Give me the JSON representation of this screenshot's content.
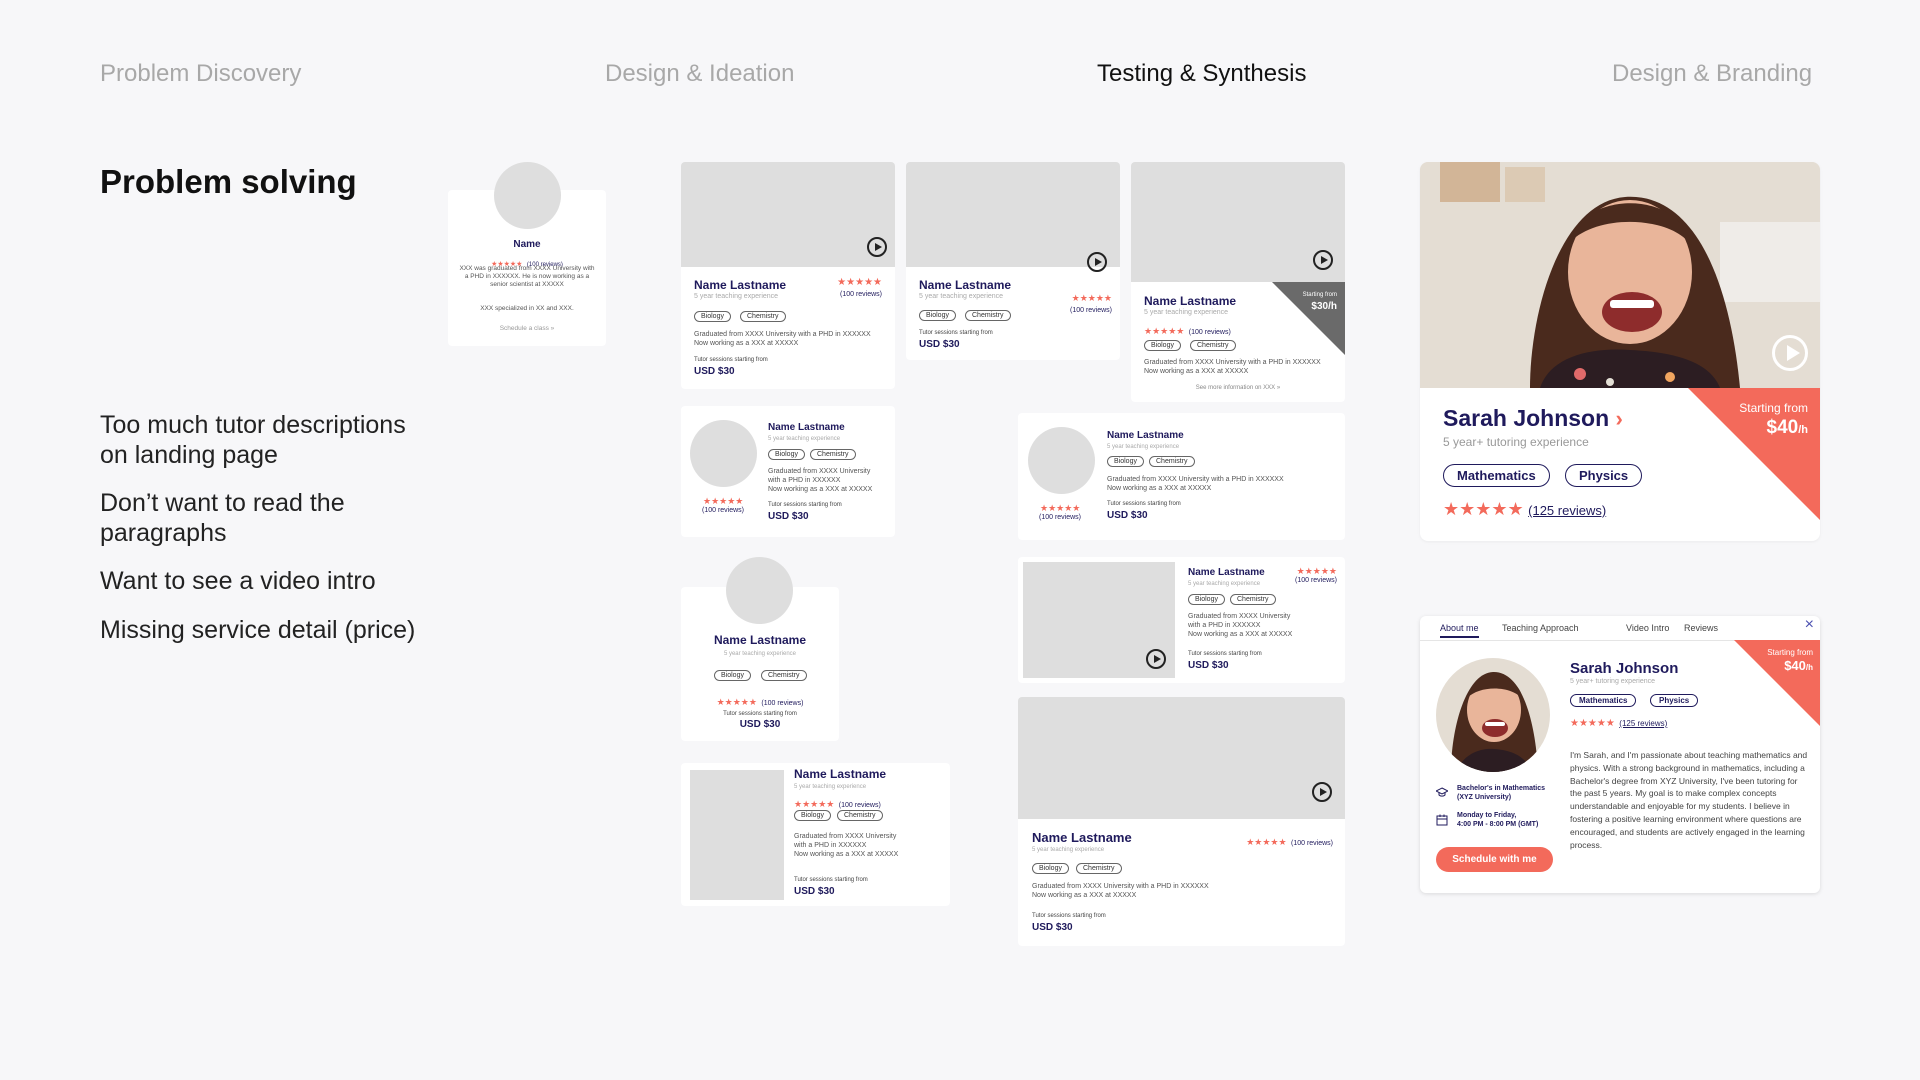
{
  "stages": [
    {
      "label": "Problem Discovery",
      "active": false
    },
    {
      "label": "Design & Ideation",
      "active": false
    },
    {
      "label": "Testing & Synthesis",
      "active": true
    },
    {
      "label": "Design & Branding",
      "active": false
    }
  ],
  "section_title": "Problem solving",
  "pain_points": [
    "Too much tutor descriptions on landing page",
    "Don’t want to read the paragraphs",
    "Want to see a video intro",
    "Missing service detail (price)"
  ],
  "wire": {
    "name": "Name Lastname",
    "name_short": "Name",
    "experience": "5 year teaching experience",
    "stars": "★★★★★",
    "reviews": "(100 reviews)",
    "tag1": "Biology",
    "tag2": "Chemistry",
    "desc_long": "Graduated from XXXX University with a PHD in XXXXXX",
    "desc_line1": "Graduated from XXXX University",
    "desc_line2": "with a PHD in XXXXXX",
    "desc_work": "Now working as a XXX at XXXXX",
    "sessions_label": "Tutor sessions starting from",
    "price": "USD $30",
    "starting_from": "Starting from",
    "corner_price": "$30/h",
    "see_more": "See more information on XXX »",
    "v1_desc1": "XXX was graduated from XXXX University with a PHD in XXXXXX.",
    "v1_desc2": "He is now working as a senior scientist at XXXXX",
    "v1_desc3": "XXX specialized in XX and XXX.",
    "v1_cta": "Schedule a class »"
  },
  "final_card": {
    "name": "Sarah Johnson",
    "experience": "5 year+ tutoring experience",
    "tags": [
      "Mathematics",
      "Physics"
    ],
    "stars": "★★★★★",
    "reviews": "(125 reviews)",
    "starting_from": "Starting from",
    "price": "$40",
    "price_unit": "/h"
  },
  "profile_modal": {
    "tabs": [
      "About me",
      "Teaching Approach",
      "Video Intro",
      "Reviews"
    ],
    "name": "Sarah Johnson",
    "experience": "5 year+ tutoring experience",
    "tags": [
      "Mathematics",
      "Physics"
    ],
    "stars": "★★★★★",
    "reviews": "(125 reviews)",
    "starting_from": "Starting from",
    "price": "$40",
    "price_unit": "/h",
    "bio": "I'm Sarah, and I'm passionate about teaching mathematics and physics. With a strong background in mathematics, including a Bachelor's degree from XYZ University, I've been tutoring for the past 5 years. My goal is to make complex concepts understandable and enjoyable for my students. I believe in fostering a positive learning environment where questions are encouraged, and students are actively engaged in the learning process.",
    "degree": "Bachelor's in Mathematics (XYZ University)",
    "availability_days": "Monday to Friday,",
    "availability_hours": "4:00 PM - 8:00 PM (GMT)",
    "cta": "Schedule with me",
    "close": "×"
  },
  "colors": {
    "accent": "#f36a5b",
    "navy": "#1f1a5c"
  }
}
